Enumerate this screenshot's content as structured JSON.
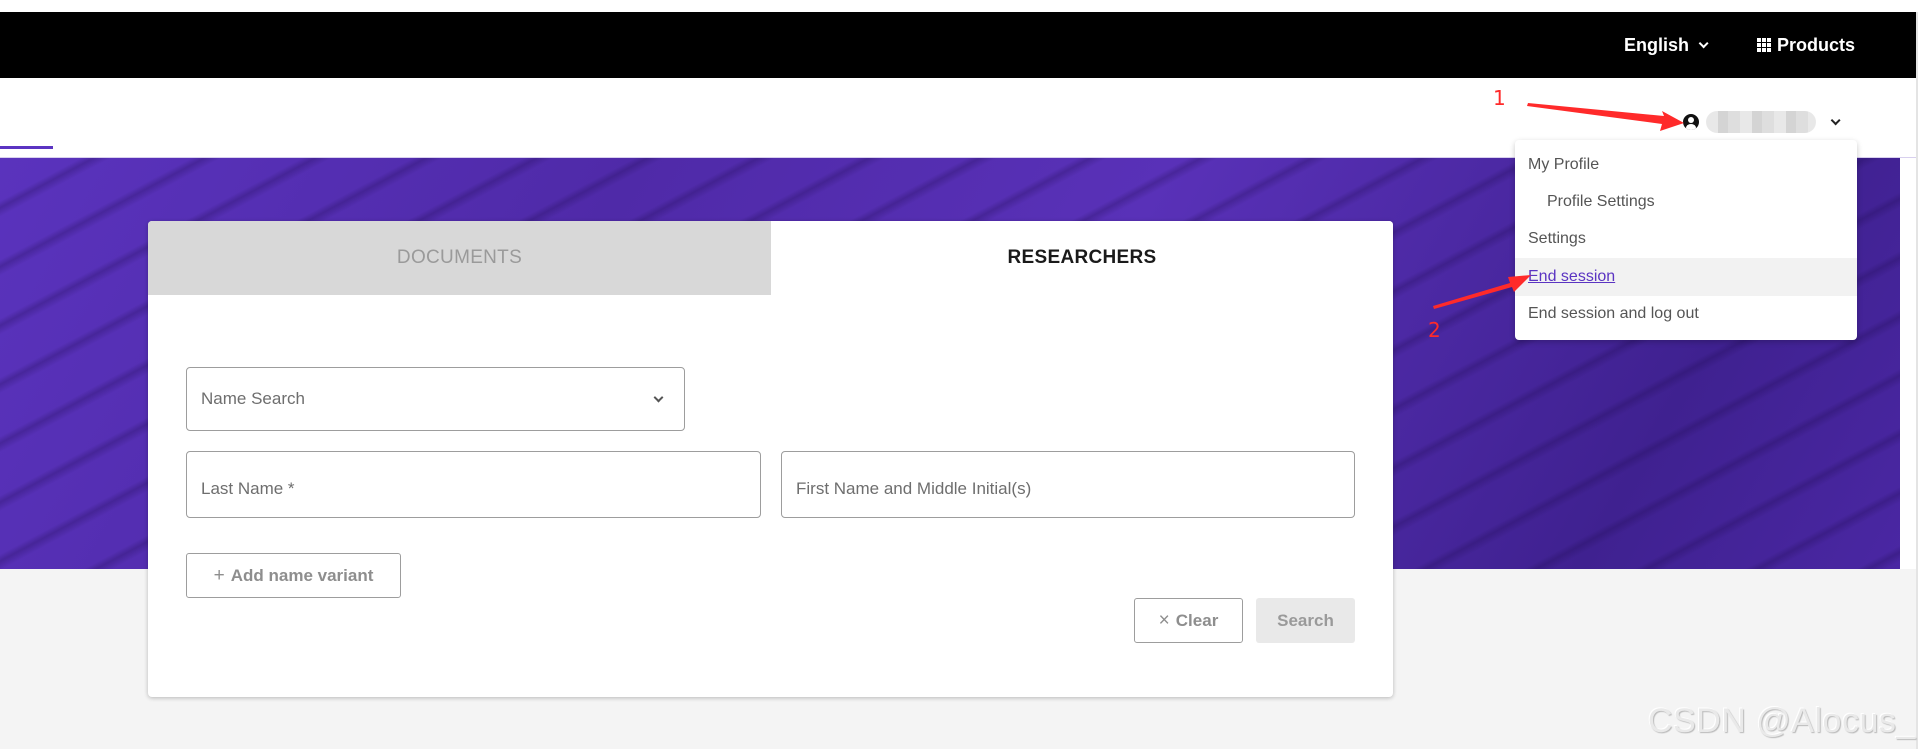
{
  "topbar": {
    "language_label": "English",
    "products_label": "Products"
  },
  "header": {
    "user_name": "",
    "user_name_redacted": true
  },
  "tabs": [
    {
      "label": "DOCUMENTS",
      "active": false
    },
    {
      "label": "RESEARCHERS",
      "active": true
    }
  ],
  "form": {
    "search_type_selected": "Name Search",
    "last_name_placeholder": "Last Name *",
    "last_name_value": "",
    "first_name_placeholder": "First Name and Middle Initial(s)",
    "first_name_value": "",
    "add_variant_label": "Add name variant",
    "add_variant_icon": "+",
    "clear_label": "Clear",
    "clear_icon": "×",
    "search_label": "Search"
  },
  "user_dropdown": {
    "items": [
      {
        "label": "My Profile",
        "indent": false,
        "active": false
      },
      {
        "label": "Profile Settings",
        "indent": true,
        "active": false
      },
      {
        "label": "Settings",
        "indent": false,
        "active": false
      },
      {
        "label": "End session",
        "indent": false,
        "active": true
      },
      {
        "label": "End session and log out",
        "indent": false,
        "active": false
      }
    ]
  },
  "annotations": {
    "step_1": "1",
    "step_2": "2"
  },
  "watermark": "CSDN @Alocus_",
  "colors": {
    "brand_purple": "#5b34c2",
    "topbar": "#000000",
    "annotation_red": "#ff2a2a"
  }
}
